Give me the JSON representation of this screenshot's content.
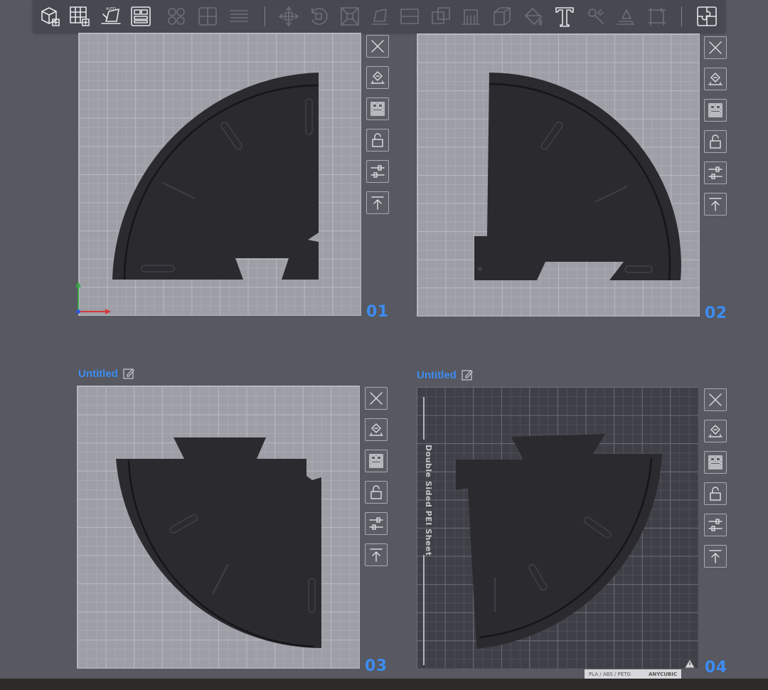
{
  "toolbar": {
    "groups": [
      [
        "add-object-icon",
        "add-plate-grid-icon",
        "auto-arrange-icon",
        "plate-layout-icon"
      ],
      [
        "arrange-disabled-icon",
        "puzzle-layout-disabled-icon",
        "stack-disabled-icon"
      ],
      [
        "move-icon",
        "rotate-icon",
        "scale-icon",
        "lay-flat-icon",
        "cut-icon",
        "merge-icon",
        "support-icon",
        "box-icon",
        "paint-icon",
        "text-tool-icon",
        "repair-icon",
        "drop-icon",
        "measure-icon"
      ],
      [
        "puzzle-icon"
      ]
    ]
  },
  "plates": [
    {
      "number": "01",
      "name": "",
      "theme": "light",
      "show_axes": true
    },
    {
      "number": "02",
      "name": "",
      "theme": "light",
      "show_axes": false
    },
    {
      "number": "03",
      "name": "Untitled",
      "theme": "light",
      "show_axes": false
    },
    {
      "number": "04",
      "name": "Untitled",
      "theme": "dark",
      "show_axes": false,
      "sheet_label": "Double Sided PEI Sheet",
      "material_label": "PLA / ABS / PETG",
      "brand": "ANYCUBIC"
    }
  ],
  "plate_side_buttons": [
    "close-plate-icon",
    "slice-plate-icon",
    "arrange-plate-icon",
    "lock-plate-icon",
    "plate-settings-icon",
    "move-to-top-icon"
  ],
  "colors": {
    "accent": "#3d8cf2",
    "part": "#2b2b2f",
    "background": "#575860"
  }
}
